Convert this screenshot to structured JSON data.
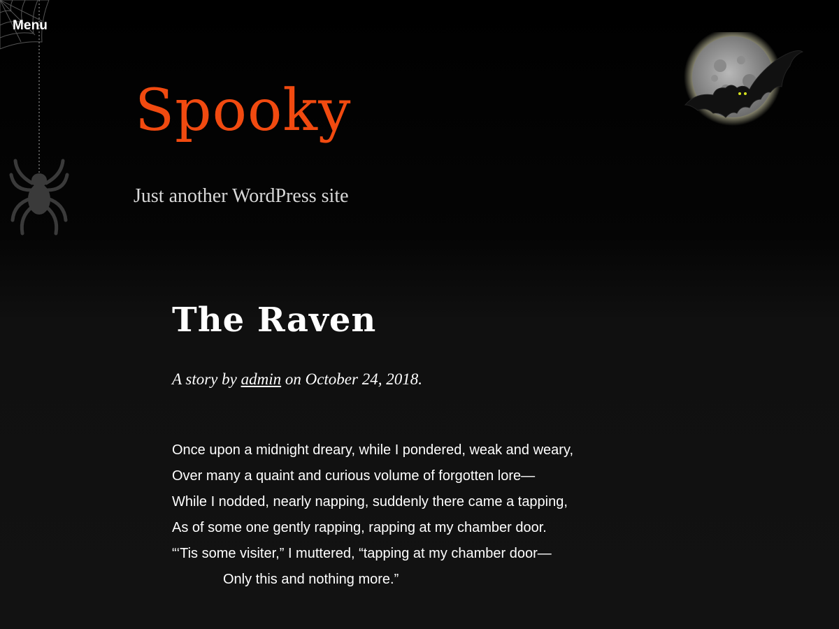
{
  "menu": {
    "label": "Menu"
  },
  "header": {
    "site_title": "Spooky",
    "tagline": "Just another WordPress site"
  },
  "post": {
    "title": "The Raven",
    "meta": {
      "prefix": "A story by",
      "author": "admin",
      "middle": "on",
      "date": "October 24, 2018."
    },
    "lines": [
      "Once upon a midnight dreary, while I pondered, weak and weary,",
      "Over many a quaint and curious volume of forgotten lore—",
      "While I nodded, nearly napping, suddenly there came a tapping,",
      "As of some one gently rapping, rapping at my chamber door.",
      "“‘Tis some visiter,” I muttered, “tapping at my chamber door—",
      "Only this and nothing more.”"
    ]
  },
  "decorations": {
    "cobweb": "cobweb-icon",
    "spider": "spider-icon",
    "moon": "moon-icon",
    "bat": "bat-icon"
  },
  "colors": {
    "background": "#000000",
    "site_title": "#f14a10",
    "text": "#ffffff",
    "moon_glow": "#fffbd0"
  }
}
